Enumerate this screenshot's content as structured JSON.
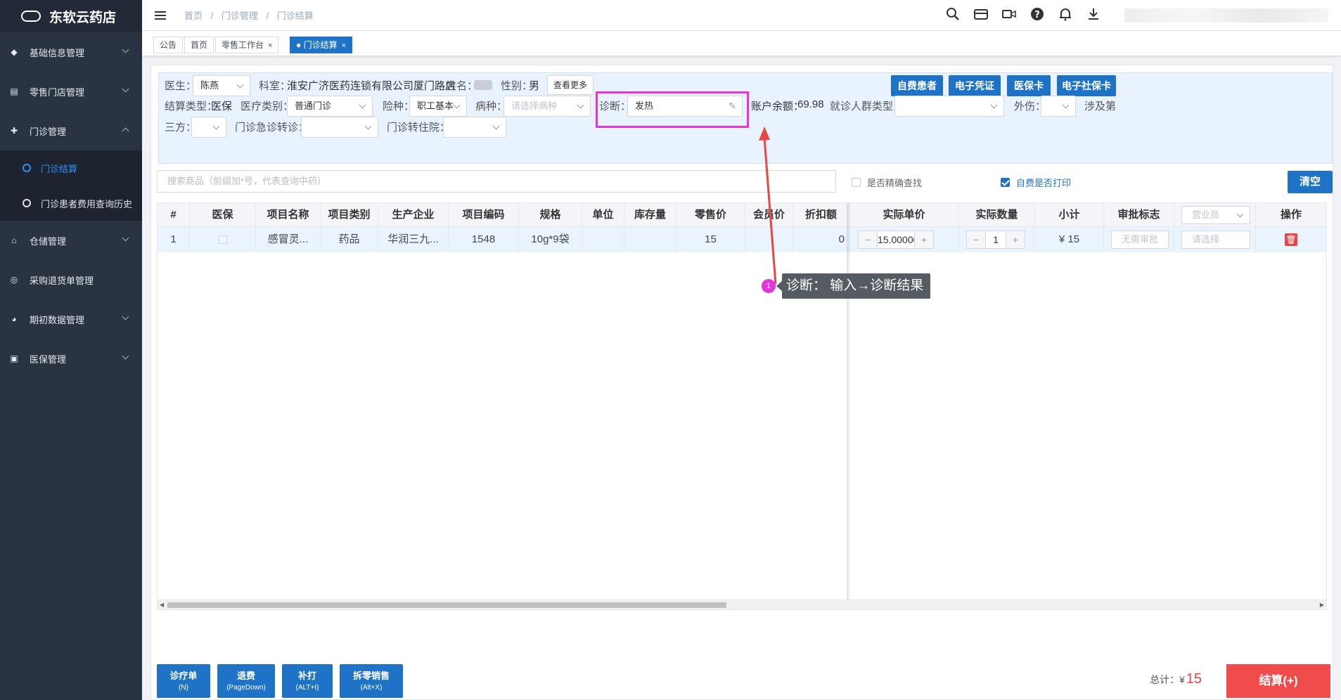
{
  "brand": {
    "name": "东软云药店"
  },
  "sidebar": {
    "items": [
      {
        "label": "基础信息管理",
        "icon": "layers-icon"
      },
      {
        "label": "零售门店管理",
        "icon": "store-icon"
      },
      {
        "label": "门诊管理",
        "icon": "clinic-icon"
      },
      {
        "label": "仓储管理",
        "icon": "warehouse-icon"
      },
      {
        "label": "采购退货单管理",
        "icon": "return-icon"
      },
      {
        "label": "期初数据管理",
        "icon": "pie-icon"
      },
      {
        "label": "医保管理",
        "icon": "card-icon"
      }
    ],
    "sub_items": [
      {
        "label": "门诊结算"
      },
      {
        "label": "门诊患者费用查询历史"
      }
    ]
  },
  "header": {
    "breadcrumb": [
      "首页",
      "/",
      "门诊管理",
      "/",
      "门诊结算"
    ]
  },
  "tabs": [
    {
      "label": "公告"
    },
    {
      "label": "首页"
    },
    {
      "label": "零售工作台",
      "close": "×"
    },
    {
      "label": "● 门诊结算",
      "close": "×"
    }
  ],
  "form": {
    "doctor_label": "医生：",
    "doctor_value": "陈燕",
    "dept_label": "科室：",
    "dept_value": "淮安广济医药连锁有限公司厦门路店",
    "name_label": "姓名：",
    "gender_label": "性别：",
    "gender_value": "男",
    "more_button": "查看更多",
    "settle_type_label": "结算类型：",
    "settle_type_value": "医保",
    "med_type_label": "医疗类别：",
    "med_type_value": "普通门诊",
    "insurance_label": "险种：",
    "insurance_value": "职工基本",
    "disease_label": "病种：",
    "disease_placeholder": "请选择病种",
    "diagnosis_label": "诊断：",
    "diagnosis_value": "发热",
    "balance_label": "账户余额：",
    "balance_value": "69.98",
    "crowd_label": "就诊人群类型：",
    "injury_label": "外伤：",
    "third_involved_label": "涉及第",
    "third_label": "三方：",
    "emergency_label": "门诊急诊转诊：",
    "hospital_label": "门诊转住院：",
    "buttons": [
      "自费患者",
      "电子凭证",
      "医保卡",
      "电子社保卡"
    ]
  },
  "search": {
    "placeholder": "搜索商品（前缀加*号，代表查询中药）",
    "exact_label": "是否精确查找",
    "print_label": "自费是否打印",
    "clear_button": "清空"
  },
  "table": {
    "columns": [
      "#",
      "医保",
      "项目名称",
      "项目类别",
      "生产企业",
      "项目编码",
      "规格",
      "单位",
      "库存量",
      "零售价",
      "会员价",
      "折扣额",
      "实际单价",
      "实际数量",
      "小计",
      "审批标志",
      "营业员",
      "操作"
    ],
    "rows": [
      {
        "index": "1",
        "name": "感冒灵...",
        "category": "药品",
        "manufacturer": "华润三九...",
        "code": "1548",
        "spec": "10g*9袋",
        "unit": "",
        "stock": "",
        "retail_price": "15",
        "member_price": "",
        "discount": "0",
        "actual_price": "15.00000",
        "quantity": "1",
        "subtotal": "¥ 15",
        "approval_placeholder": "无需审批",
        "clerk_placeholder": "请选择"
      }
    ]
  },
  "bottom": {
    "buttons": [
      {
        "label": "诊疗单",
        "shortcut": "(N)"
      },
      {
        "label": "退费",
        "shortcut": "(PageDown)"
      },
      {
        "label": "补打",
        "shortcut": "(ALT+I)"
      },
      {
        "label": "拆零销售",
        "shortcut": "(Alt+X)"
      }
    ],
    "total_label": "总计：¥",
    "total_value": "15",
    "settle_button": "结算(+)"
  },
  "annotation": {
    "number": "1",
    "text": "诊断： 输入→诊断结果"
  },
  "colors": {
    "sidebar": "#2a3342",
    "primary": "#1f73c7",
    "highlight": "#e535d9",
    "settle": "#f04c4c"
  }
}
